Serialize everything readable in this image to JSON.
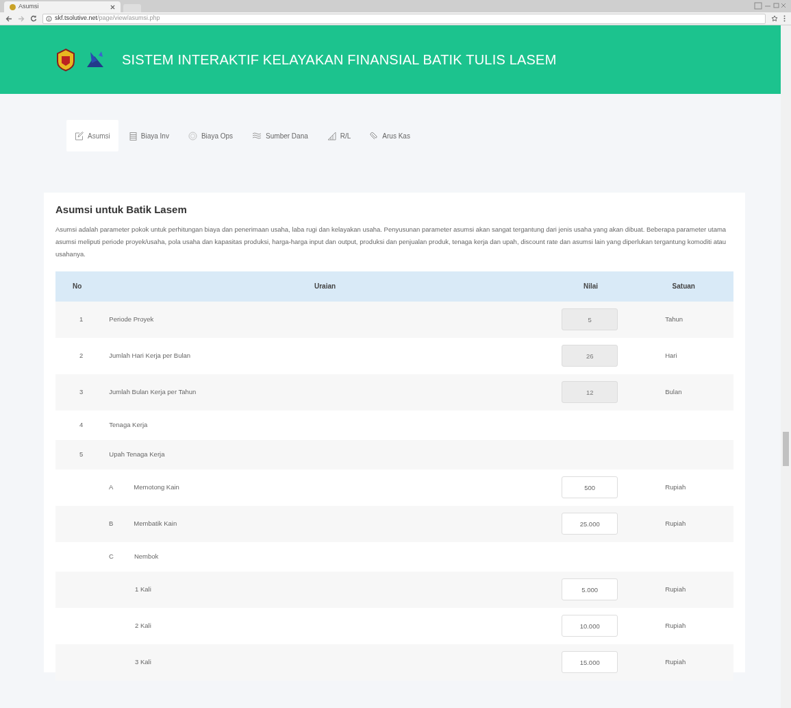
{
  "browser": {
    "tab_title": "Asumsi",
    "url_host": "skf.tsolutive.net",
    "url_path": "/page/view/asumsi.php"
  },
  "header": {
    "title": "SISTEM INTERAKTIF KELAYAKAN FINANSIAL BATIK TULIS LASEM"
  },
  "nav": [
    {
      "label": "Asumsi",
      "selected": true
    },
    {
      "label": "Biaya Inv",
      "selected": false
    },
    {
      "label": "Biaya Ops",
      "selected": false
    },
    {
      "label": "Sumber Dana",
      "selected": false
    },
    {
      "label": "R/L",
      "selected": false
    },
    {
      "label": "Arus Kas",
      "selected": false
    }
  ],
  "card": {
    "title": "Asumsi untuk Batik Lasem",
    "description": "Asumsi adalah parameter pokok untuk perhitungan biaya dan penerimaan usaha, laba rugi dan kelayakan usaha. Penyusunan parameter asumsi akan sangat tergantung dari jenis usaha yang akan dibuat. Beberapa parameter utama asumsi meliputi periode proyek/usaha, pola usaha dan kapasitas produksi, harga-harga input dan output, produksi dan penjualan produk, tenaga kerja dan upah, discount rate dan asumsi lain yang diperlukan tergantung komoditi atau usahanya."
  },
  "table": {
    "columns": [
      "No",
      "Uraian",
      "Nilai",
      "Satuan"
    ],
    "rows": [
      {
        "no": "1",
        "label": "Periode Proyek",
        "value": "5",
        "disabled": true,
        "unit": "Tahun"
      },
      {
        "no": "2",
        "label": "Jumlah Hari Kerja per Bulan",
        "value": "26",
        "disabled": true,
        "unit": "Hari"
      },
      {
        "no": "3",
        "label": "Jumlah Bulan Kerja per Tahun",
        "value": "12",
        "disabled": true,
        "unit": "Bulan"
      },
      {
        "no": "4",
        "label": "Tenaga Kerja"
      },
      {
        "no": "5",
        "label": "Upah Tenaga Kerja",
        "children": [
          {
            "no": "A",
            "label": "Memotong Kain",
            "value": "500",
            "disabled": false,
            "unit": "Rupiah"
          },
          {
            "no": "B",
            "label": "Membatik Kain",
            "value": "25.000",
            "disabled": false,
            "unit": "Rupiah"
          },
          {
            "no": "C",
            "label": "Nembok",
            "children": [
              {
                "label": "1 Kali",
                "value": "5.000",
                "disabled": false,
                "unit": "Rupiah"
              },
              {
                "label": "2 Kali",
                "value": "10.000",
                "disabled": false,
                "unit": "Rupiah"
              },
              {
                "label": "3 Kali",
                "value": "15.000",
                "disabled": false,
                "unit": "Rupiah"
              }
            ]
          }
        ]
      }
    ]
  }
}
